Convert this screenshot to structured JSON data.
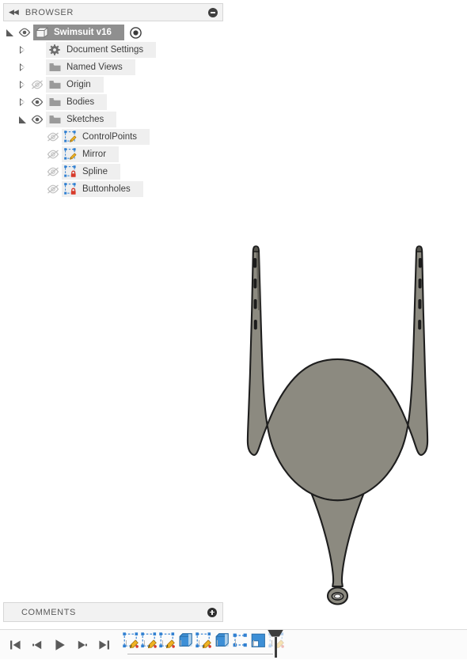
{
  "browser": {
    "header": {
      "title": "BROWSER",
      "collapse_icon": "double-left-chevron-icon",
      "minimize_icon": "minimize-dot-icon"
    },
    "tree": [
      {
        "label": "Swimsuit v16",
        "level": 0,
        "expander": "open",
        "visibility_icon": "eye-visible-icon",
        "type_icon": "component-cube-icon",
        "selected": true,
        "trailing_icon": "activate-target-icon"
      },
      {
        "label": "Document Settings",
        "level": 1,
        "expander": "closed",
        "visibility_icon": "none",
        "type_icon": "gear-icon",
        "selected": false
      },
      {
        "label": "Named Views",
        "level": 1,
        "expander": "closed",
        "visibility_icon": "none",
        "type_icon": "folder-icon",
        "selected": false
      },
      {
        "label": "Origin",
        "level": 1,
        "expander": "closed",
        "visibility_icon": "eye-hidden-icon",
        "type_icon": "folder-icon",
        "selected": false
      },
      {
        "label": "Bodies",
        "level": 1,
        "expander": "closed",
        "visibility_icon": "eye-visible-icon",
        "type_icon": "folder-icon",
        "selected": false
      },
      {
        "label": "Sketches",
        "level": 1,
        "expander": "open",
        "visibility_icon": "eye-visible-icon",
        "type_icon": "folder-icon",
        "selected": false
      },
      {
        "label": "ControlPoints",
        "level": 2,
        "expander": "none",
        "visibility_icon": "eye-hidden-icon",
        "type_icon": "sketch-unlocked-icon",
        "selected": false
      },
      {
        "label": "Mirror",
        "level": 2,
        "expander": "none",
        "visibility_icon": "eye-hidden-icon",
        "type_icon": "sketch-unlocked-icon",
        "selected": false
      },
      {
        "label": "Spline",
        "level": 2,
        "expander": "none",
        "visibility_icon": "eye-hidden-icon",
        "type_icon": "sketch-locked-icon",
        "selected": false
      },
      {
        "label": "Buttonholes",
        "level": 2,
        "expander": "none",
        "visibility_icon": "eye-hidden-icon",
        "type_icon": "sketch-locked-icon",
        "selected": false
      }
    ]
  },
  "comments": {
    "title": "COMMENTS",
    "add_icon": "add-comment-plus-icon"
  },
  "timeline": {
    "playback": [
      {
        "name": "skip-to-beginning",
        "icon": "skip-start-icon"
      },
      {
        "name": "step-backward",
        "icon": "step-back-icon"
      },
      {
        "name": "play",
        "icon": "play-icon"
      },
      {
        "name": "step-forward",
        "icon": "step-forward-icon"
      },
      {
        "name": "skip-to-end",
        "icon": "skip-end-icon"
      }
    ],
    "features": [
      {
        "name": "sketch-1",
        "icon": "sketch-feature-icon",
        "state": "active"
      },
      {
        "name": "sketch-2",
        "icon": "sketch-feature-icon",
        "state": "active"
      },
      {
        "name": "sketch-3",
        "icon": "sketch-feature-icon",
        "state": "active"
      },
      {
        "name": "body-1",
        "icon": "solid-body-feature-icon",
        "state": "active"
      },
      {
        "name": "sketch-4",
        "icon": "sketch-feature-icon",
        "state": "active"
      },
      {
        "name": "body-2",
        "icon": "solid-body-feature-icon",
        "state": "active"
      },
      {
        "name": "construction-1",
        "icon": "construction-feature-icon",
        "state": "active"
      },
      {
        "name": "patch-1",
        "icon": "patch-feature-icon",
        "state": "active"
      },
      {
        "name": "sketch-5",
        "icon": "sketch-feature-icon",
        "state": "suppressed"
      }
    ],
    "playhead_name": "timeline-marker"
  },
  "canvas": {
    "model_name": "swimsuit-body",
    "fill_color": "#8c8a80",
    "edge_color": "#1e1e1e",
    "strap_buttonhole_count": 4
  }
}
